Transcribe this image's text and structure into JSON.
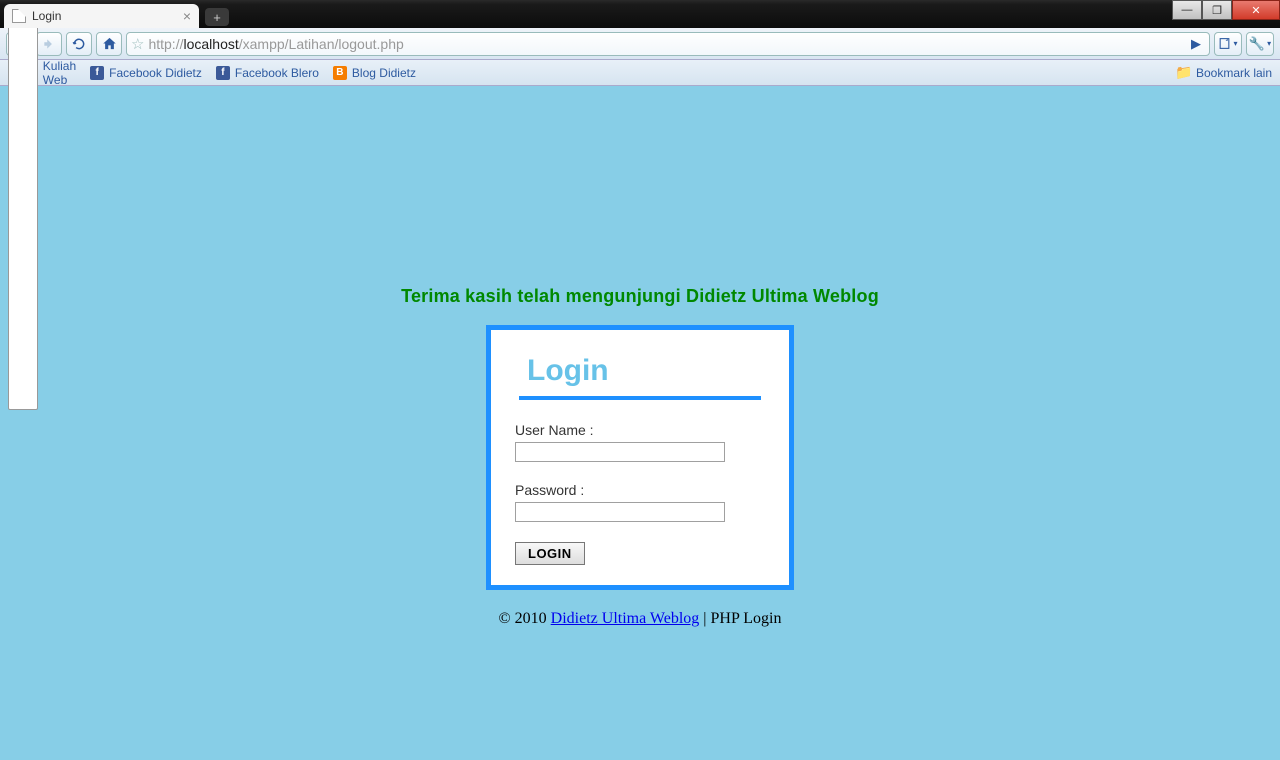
{
  "browser": {
    "tab_title": "Login",
    "url_scheme": "http://",
    "url_host": "localhost",
    "url_path": "/xampp/Latihan/logout.php"
  },
  "bookmarks": {
    "items": [
      {
        "label": "Kuliah Web",
        "icon": "page"
      },
      {
        "label": "Facebook Didietz",
        "icon": "fb"
      },
      {
        "label": "Facebook Blero",
        "icon": "fb"
      },
      {
        "label": "Blog Didietz",
        "icon": "blogger"
      }
    ],
    "other": "Bookmark lain"
  },
  "page": {
    "thanks": "Terima kasih telah mengunjungi Didietz Ultima Weblog",
    "login_title": "Login",
    "username_label": "User Name :",
    "password_label": "Password :",
    "login_button": "LOGIN",
    "footer_prefix": "© 2010 ",
    "footer_link": "Didietz Ultima Weblog",
    "footer_suffix": " | PHP Login"
  }
}
